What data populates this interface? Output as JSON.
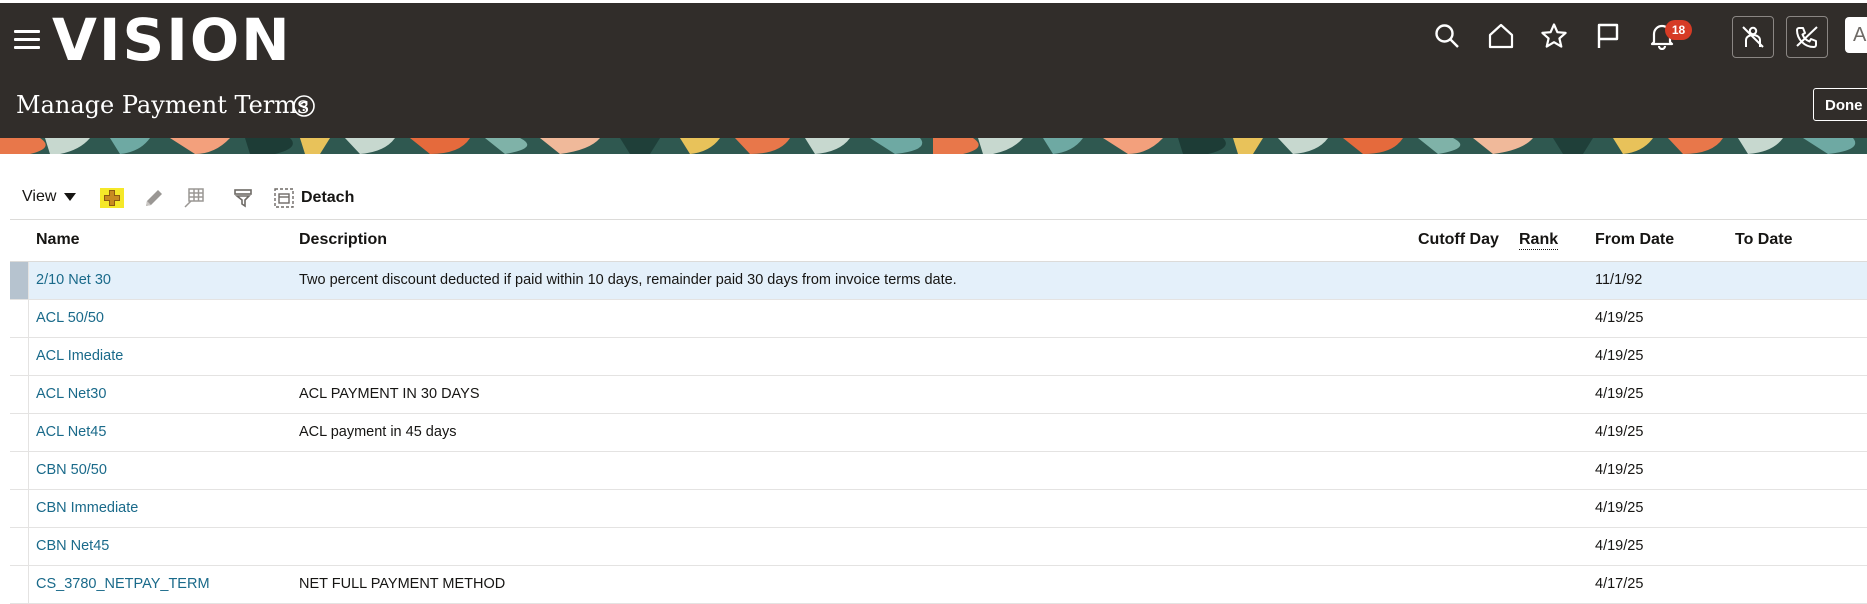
{
  "app": {
    "logo": "VISION",
    "page_title": "Manage Payment Terms",
    "done_label": "Done",
    "user_initials": "Al"
  },
  "header_icons": [
    "menu-icon",
    "search-icon",
    "home-icon",
    "star-icon",
    "flag-icon",
    "bell-icon"
  ],
  "notifications": {
    "count": "18"
  },
  "toolbar": {
    "view_label": "View",
    "detach_label": "Detach"
  },
  "table": {
    "columns": [
      "Name",
      "Description",
      "Cutoff Day",
      "Rank",
      "From Date",
      "To Date"
    ],
    "rows": [
      {
        "name": "2/10 Net 30",
        "description": "Two percent discount deducted if paid within 10 days, remainder paid 30 days from invoice terms date.",
        "cutoff": "",
        "rank": "",
        "from": "11/1/92",
        "to": ""
      },
      {
        "name": "ACL 50/50",
        "description": "",
        "cutoff": "",
        "rank": "",
        "from": "4/19/25",
        "to": ""
      },
      {
        "name": "ACL Imediate",
        "description": "",
        "cutoff": "",
        "rank": "",
        "from": "4/19/25",
        "to": ""
      },
      {
        "name": "ACL Net30",
        "description": "ACL PAYMENT IN 30 DAYS",
        "cutoff": "",
        "rank": "",
        "from": "4/19/25",
        "to": ""
      },
      {
        "name": "ACL Net45",
        "description": "ACL payment in 45 days",
        "cutoff": "",
        "rank": "",
        "from": "4/19/25",
        "to": ""
      },
      {
        "name": "CBN 50/50",
        "description": "",
        "cutoff": "",
        "rank": "",
        "from": "4/19/25",
        "to": ""
      },
      {
        "name": "CBN Immediate",
        "description": "",
        "cutoff": "",
        "rank": "",
        "from": "4/19/25",
        "to": ""
      },
      {
        "name": "CBN Net45",
        "description": "",
        "cutoff": "",
        "rank": "",
        "from": "4/19/25",
        "to": ""
      },
      {
        "name": "CS_3780_NETPAY_TERM",
        "description": "NET FULL PAYMENT METHOD",
        "cutoff": "",
        "rank": "",
        "from": "4/17/25",
        "to": ""
      }
    ]
  },
  "colors": {
    "header_bg": "#312d2a",
    "link": "#1a6a8a",
    "selected_row": "#e4f0fa",
    "badge": "#d63b25",
    "add_highlight": "#f5e829"
  }
}
